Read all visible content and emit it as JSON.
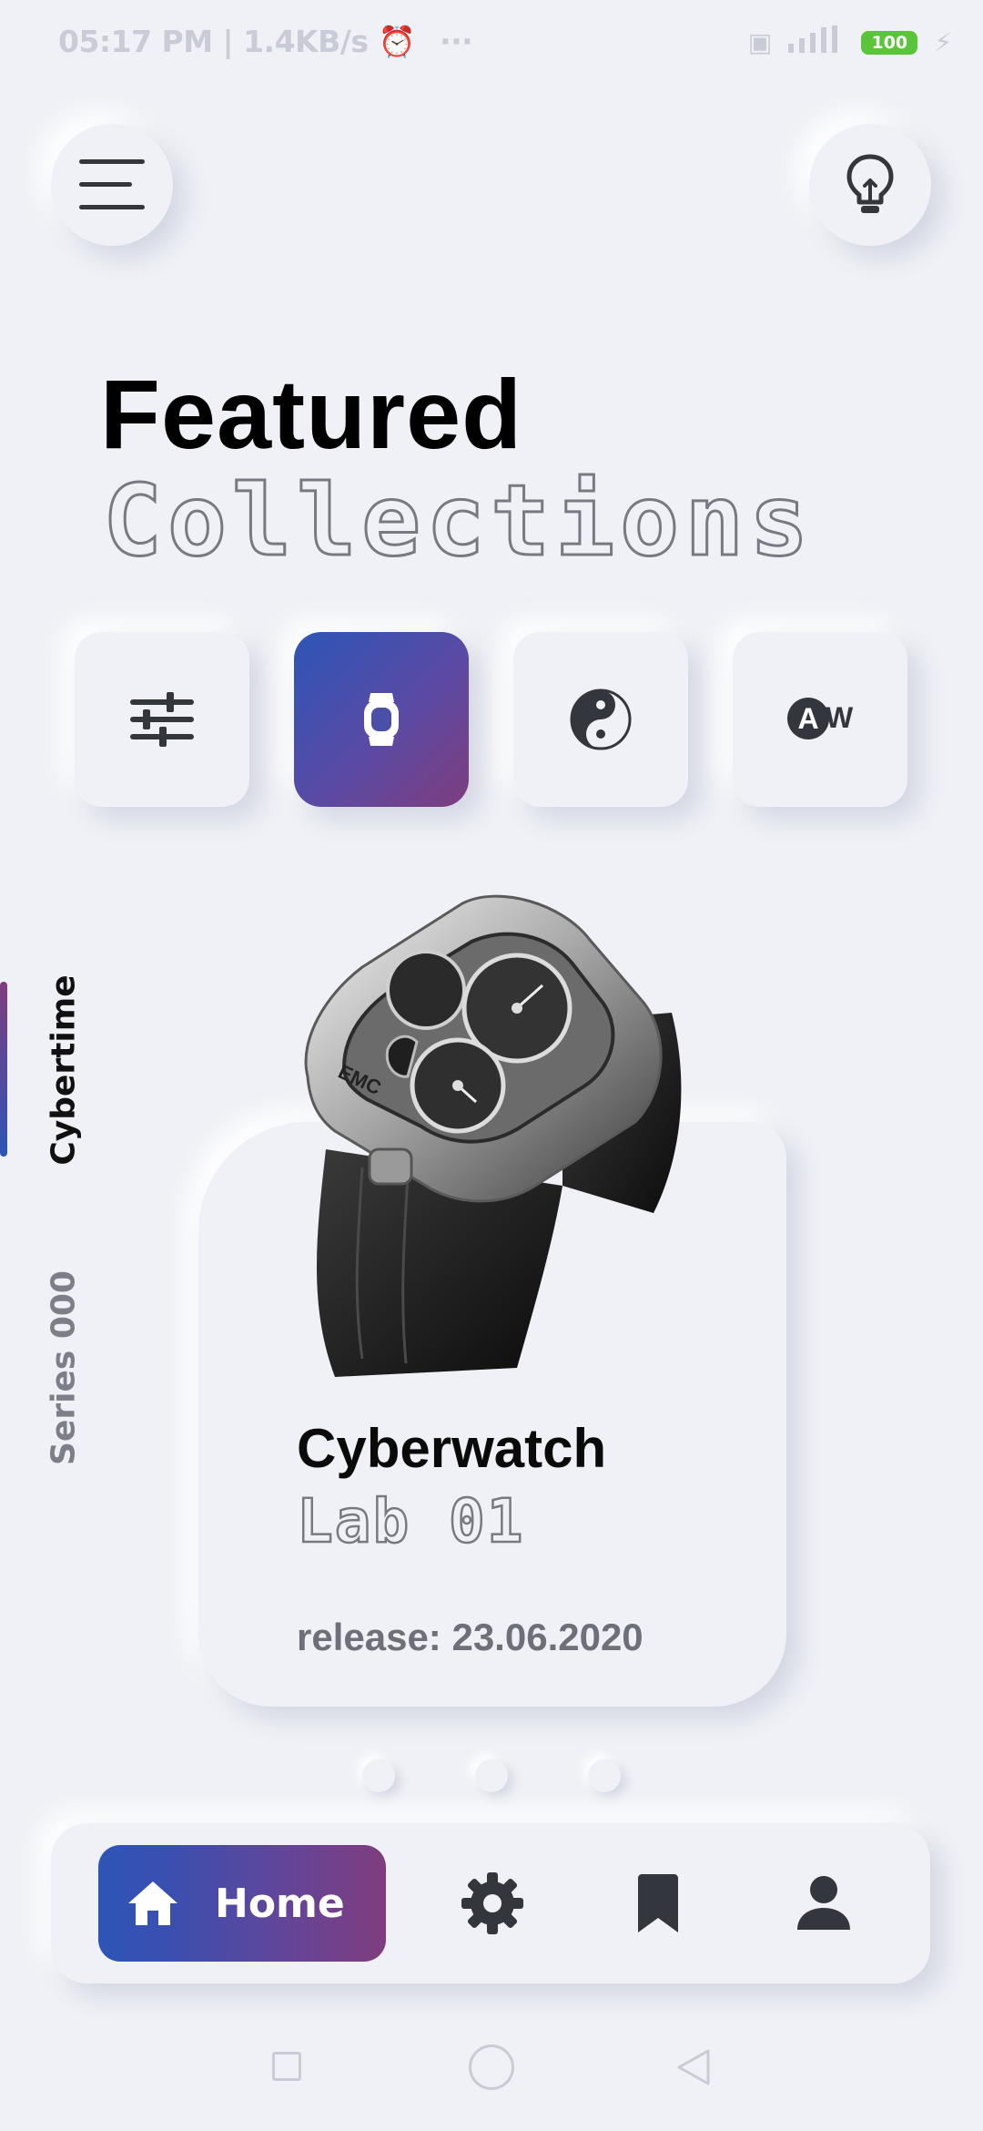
{
  "status_bar": {
    "time_speed": "05:17 PM | 1.4KB/s",
    "dots": "···",
    "battery": "100",
    "colors": {
      "battery": "#5ac43a",
      "text": "#c9ccd6"
    }
  },
  "header": {
    "menu_icon": "hamburger-menu-icon",
    "idea_icon": "lightbulb-icon"
  },
  "title": {
    "line1": "Featured",
    "line2": "Collections"
  },
  "categories": [
    {
      "icon": "sliders-icon",
      "selected": false
    },
    {
      "icon": "watch-icon",
      "selected": true
    },
    {
      "icon": "yin-yang-icon",
      "selected": false
    },
    {
      "icon": "aw-logo-icon",
      "selected": false,
      "label": "W",
      "badge": "A"
    }
  ],
  "side_tabs": [
    {
      "label": "Cybertime",
      "active": true
    },
    {
      "label": "Series 000",
      "active": false
    }
  ],
  "product": {
    "name": "Cyberwatch",
    "subtitle": "Lab 01",
    "release": "release: 23.06.2020",
    "image_icon": "watch-product-image"
  },
  "pager": {
    "count": 3,
    "active_index": 0
  },
  "bottom_nav": {
    "home_label": "Home",
    "items": [
      "home-icon",
      "settings-gear-icon",
      "bookmark-icon",
      "user-profile-icon"
    ]
  },
  "accent_colors": {
    "gradient_start": "#2d55b7",
    "gradient_end": "#7f3d7e",
    "background": "#eff1f6"
  }
}
